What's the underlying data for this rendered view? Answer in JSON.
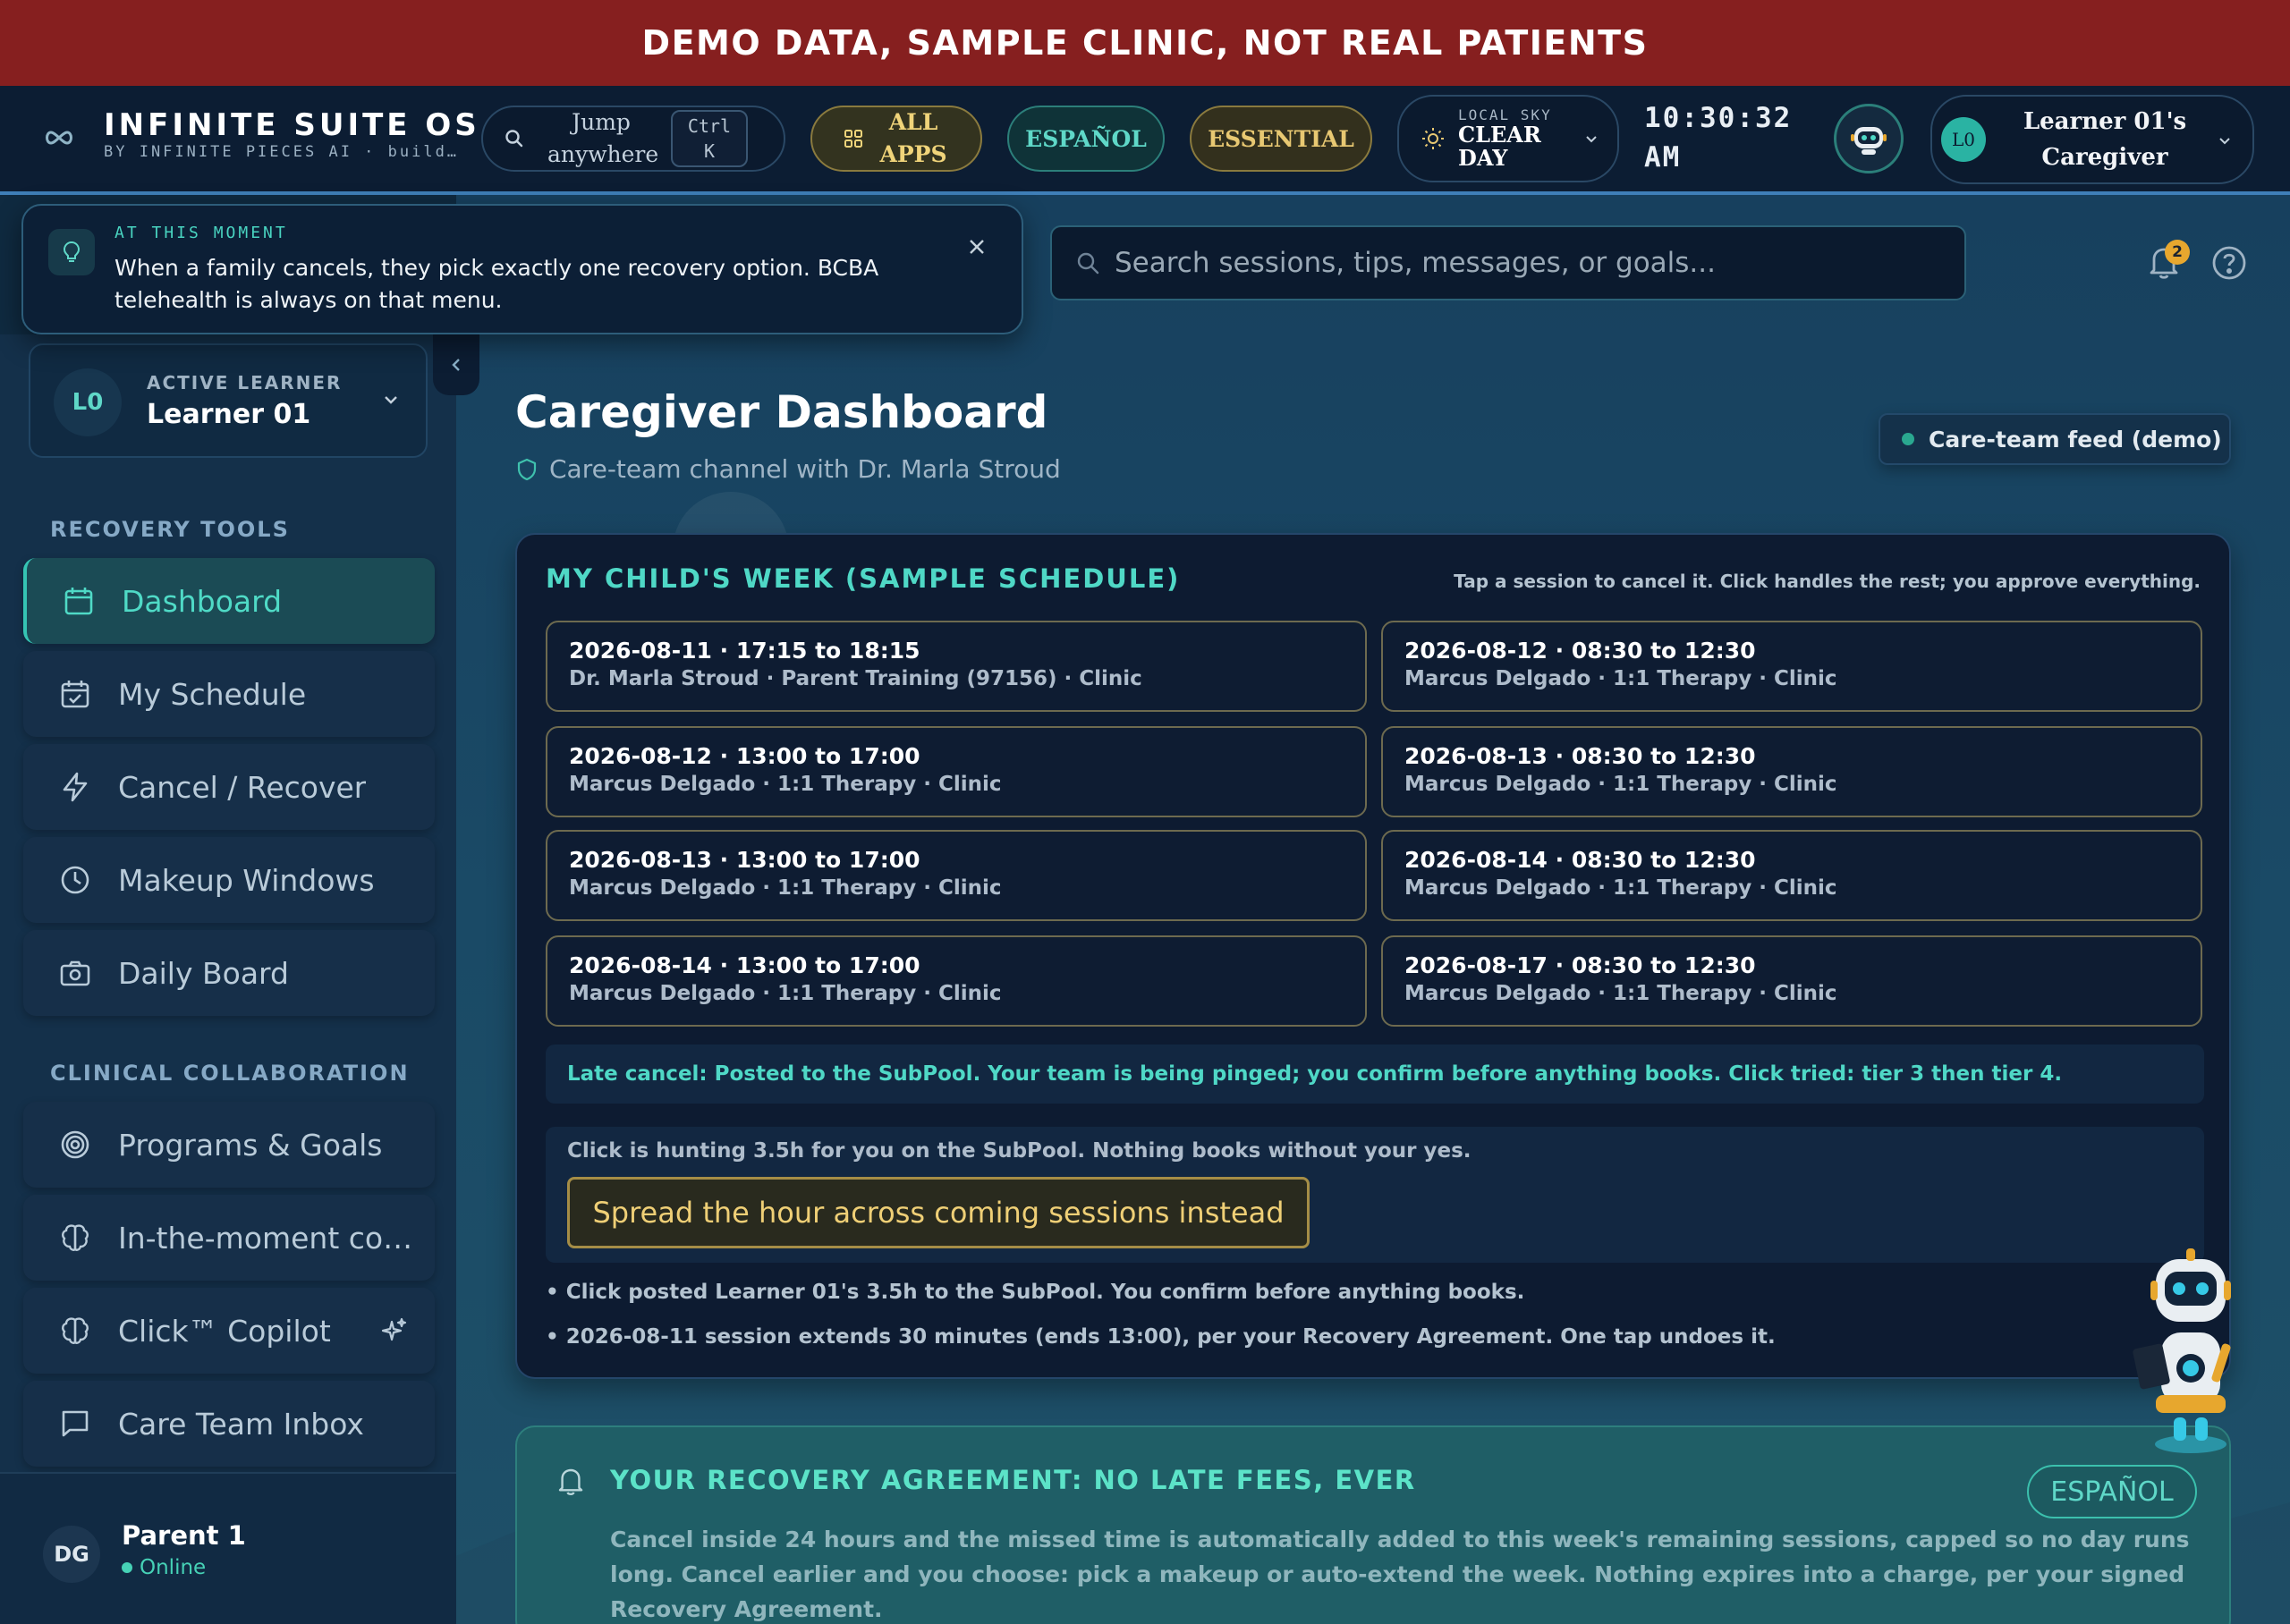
{
  "banner": "DEMO DATA, SAMPLE CLINIC, NOT REAL PATIENTS",
  "brand": {
    "title": "INFINITE SUITE OS",
    "subtitle": "BY INFINITE PIECES AI · build…"
  },
  "topbar": {
    "jump_label": "Jump anywhere",
    "kbd_key1": "Ctrl",
    "kbd_key2": "K",
    "all_apps": "ALL APPS",
    "espanol": "ESPAÑOL",
    "essential": "ESSENTIAL",
    "weather_label": "LOCAL SKY",
    "weather_value": "CLEAR DAY",
    "clock_time": "10:30:32",
    "clock_ampm": "AM",
    "account_avatar": "L0",
    "account_name": "Learner 01's Caregiver"
  },
  "moment": {
    "label": "AT THIS MOMENT",
    "text": "When a family cancels, they pick exactly one recovery option. BCBA telehealth is always on that menu."
  },
  "search": {
    "placeholder": "Search sessions, tips, messages, or goals..."
  },
  "notifications": {
    "count": "2"
  },
  "sidebar": {
    "learner_avatar": "L0",
    "learner_label": "ACTIVE LEARNER",
    "learner_name": "Learner 01",
    "section1": "RECOVERY TOOLS",
    "section2": "CLINICAL COLLABORATION",
    "items": [
      {
        "label": "Dashboard",
        "icon": "calendar-icon",
        "active": true
      },
      {
        "label": "My Schedule",
        "icon": "calendar-check-icon"
      },
      {
        "label": "Cancel / Recover",
        "icon": "lightning-icon"
      },
      {
        "label": "Makeup Windows",
        "icon": "clock-icon"
      },
      {
        "label": "Daily Board",
        "icon": "camera-icon"
      },
      {
        "label": "Programs & Goals",
        "icon": "target-icon"
      },
      {
        "label": "In-the-moment co…",
        "icon": "brain-icon"
      },
      {
        "label": "Click™ Copilot",
        "icon": "brain-icon"
      },
      {
        "label": "Care Team Inbox",
        "icon": "message-icon"
      }
    ],
    "user_avatar": "DG",
    "user_name": "Parent 1",
    "user_status": "Online"
  },
  "main": {
    "title": "Caregiver Dashboard",
    "subtitle": "Care-team channel with Dr. Marla Stroud",
    "feed": "Care-team feed (demo)"
  },
  "week": {
    "title": "MY CHILD'S WEEK (SAMPLE SCHEDULE)",
    "hint": "Tap a session to cancel it. Click handles the rest; you approve everything.",
    "sessions": [
      {
        "time": "2026-08-11 · 17:15 to 18:15",
        "detail": "Dr. Marla Stroud · Parent Training (97156) · Clinic"
      },
      {
        "time": "2026-08-12 · 08:30 to 12:30",
        "detail": "Marcus Delgado · 1:1 Therapy · Clinic"
      },
      {
        "time": "2026-08-12 · 13:00 to 17:00",
        "detail": "Marcus Delgado · 1:1 Therapy · Clinic"
      },
      {
        "time": "2026-08-13 · 08:30 to 12:30",
        "detail": "Marcus Delgado · 1:1 Therapy · Clinic"
      },
      {
        "time": "2026-08-13 · 13:00 to 17:00",
        "detail": "Marcus Delgado · 1:1 Therapy · Clinic"
      },
      {
        "time": "2026-08-14 · 08:30 to 12:30",
        "detail": "Marcus Delgado · 1:1 Therapy · Clinic"
      },
      {
        "time": "2026-08-14 · 13:00 to 17:00",
        "detail": "Marcus Delgado · 1:1 Therapy · Clinic"
      },
      {
        "time": "2026-08-17 · 08:30 to 12:30",
        "detail": "Marcus Delgado · 1:1 Therapy · Clinic"
      }
    ],
    "late_cancel": "Late cancel: Posted to the SubPool. Your team is being pinged; you confirm before anything books. Click tried: tier 3 then tier 4.",
    "hunting": "Click is hunting 3.5h for you on the SubPool. Nothing books without your yes.",
    "spread_button": "Spread the hour across coming sessions instead",
    "bullet1": "• Click posted Learner 01's 3.5h to the SubPool. You confirm before anything books.",
    "bullet2": "• 2026-08-11 session extends 30 minutes (ends 13:00), per your Recovery Agreement. One tap undoes it."
  },
  "agreement": {
    "title": "YOUR RECOVERY AGREEMENT: NO LATE FEES, EVER",
    "espanol": "ESPAÑOL",
    "text": "Cancel inside 24 hours and the missed time is automatically added to this week's remaining sessions, capped so no day runs long. Cancel earlier and you choose: pick a makeup or auto-extend the week. Nothing expires into a charge, per your signed Recovery Agreement."
  },
  "colors": {
    "banner": "#861f1f",
    "accent_teal": "#4fd8c6",
    "accent_gold": "#efcf76",
    "background": "#0f2a40"
  }
}
